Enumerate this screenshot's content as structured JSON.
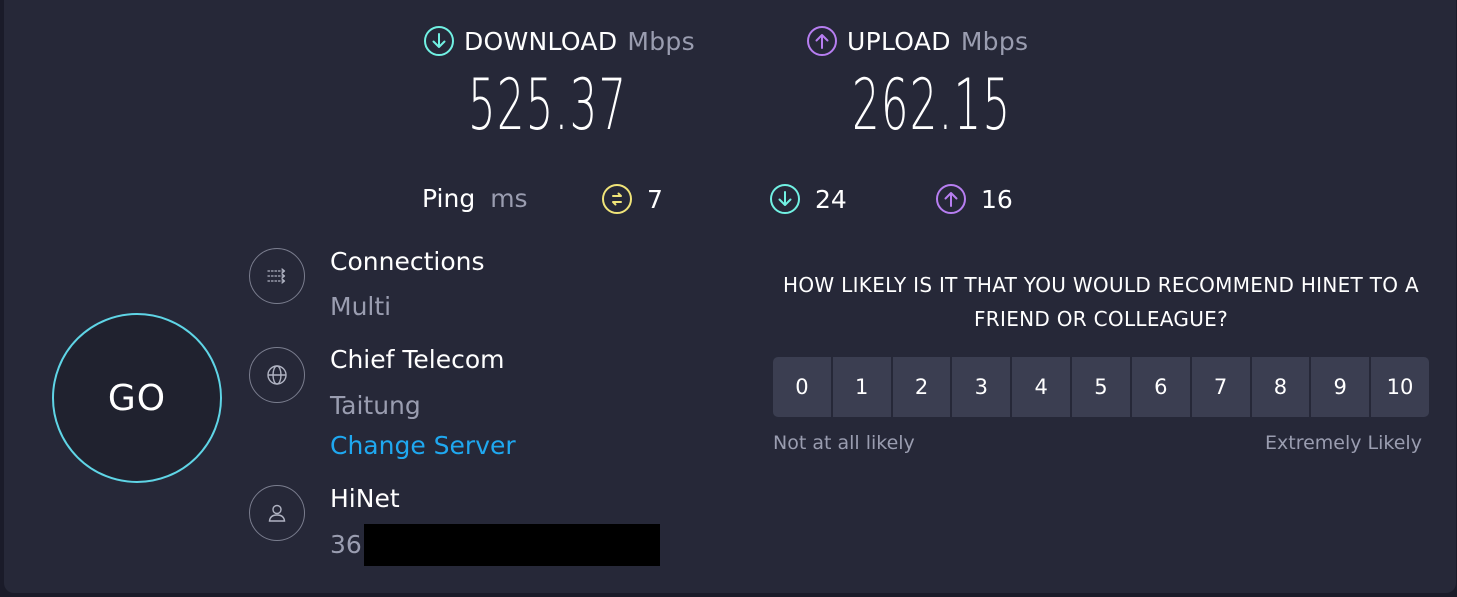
{
  "download": {
    "label": "DOWNLOAD",
    "unit": "Mbps",
    "value": "525.37"
  },
  "upload": {
    "label": "UPLOAD",
    "unit": "Mbps",
    "value": "262.15"
  },
  "ping": {
    "label": "Ping",
    "unit": "ms",
    "idle": "7",
    "download": "24",
    "upload": "16"
  },
  "go_label": "GO",
  "connections": {
    "title": "Connections",
    "value": "Multi"
  },
  "server": {
    "name": "Chief Telecom",
    "location": "Taitung",
    "change_label": "Change Server"
  },
  "provider": {
    "name": "HiNet",
    "ip_visible": "36."
  },
  "survey": {
    "question": "HOW LIKELY IS IT THAT YOU WOULD RECOMMEND HINET TO A FRIEND OR COLLEAGUE?",
    "scale": [
      "0",
      "1",
      "2",
      "3",
      "4",
      "5",
      "6",
      "7",
      "8",
      "9",
      "10"
    ],
    "low_label": "Not at all likely",
    "high_label": "Extremely Likely"
  },
  "colors": {
    "download": "#71f1e3",
    "upload": "#b77ef1",
    "ping": "#f0e479",
    "link": "#1fa8f0",
    "background": "#262838"
  }
}
